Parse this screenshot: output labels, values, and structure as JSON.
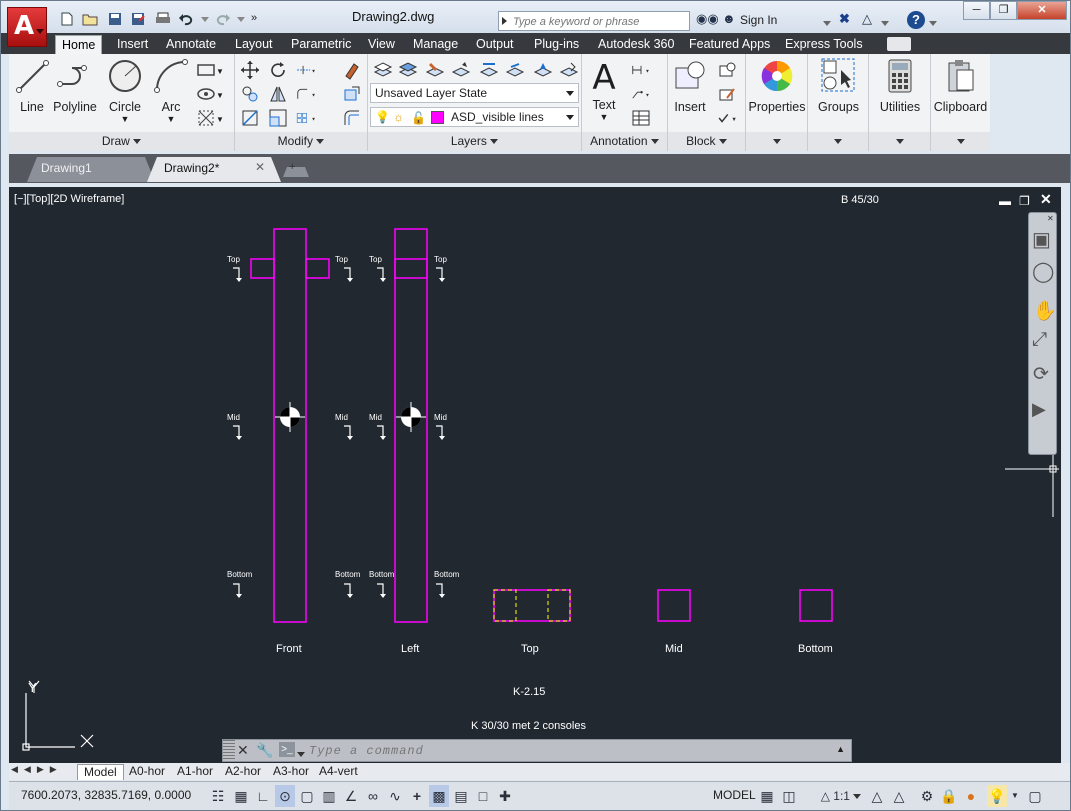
{
  "app": {
    "document_title": "Drawing2.dwg",
    "search_placeholder": "Type a keyword or phrase",
    "sign_in": "Sign In"
  },
  "ribbon_tabs": [
    "Home",
    "Insert",
    "Annotate",
    "Layout",
    "Parametric",
    "View",
    "Manage",
    "Output",
    "Plug-ins",
    "Autodesk 360",
    "Featured Apps",
    "Express Tools"
  ],
  "panels": {
    "draw": {
      "title": "Draw",
      "tools": [
        "Line",
        "Polyline",
        "Circle",
        "Arc"
      ]
    },
    "modify": {
      "title": "Modify"
    },
    "layers": {
      "title": "Layers",
      "layer_state": "Unsaved Layer State",
      "current_layer": "ASD_visible lines",
      "layer_color": "#ff00ff"
    },
    "annotation": {
      "title": "Annotation",
      "text_label": "Text"
    },
    "block": {
      "title": "Block",
      "insert_label": "Insert"
    },
    "properties": {
      "label": "Properties"
    },
    "groups": {
      "label": "Groups"
    },
    "utilities": {
      "label": "Utilities"
    },
    "clipboard": {
      "label": "Clipboard"
    }
  },
  "file_tabs": [
    {
      "label": "Drawing1",
      "active": false
    },
    {
      "label": "Drawing2*",
      "active": true
    }
  ],
  "viewport": {
    "label": "[−][Top][2D Wireframe]",
    "scale_label": "B 45/30"
  },
  "drawing": {
    "column_color": "#ff00ff",
    "hidden_line_color": "#ffff00",
    "section_markers": {
      "top": "Top",
      "mid": "Mid",
      "bottom": "Bottom"
    },
    "view_labels": [
      "Front",
      "Left",
      "Top",
      "Mid",
      "Bottom"
    ],
    "code": "K-2.15",
    "description": "K 30/30 met 2 consoles",
    "ucs_labels": [
      "Y",
      "X"
    ]
  },
  "command_line": {
    "placeholder": "Type a command"
  },
  "layout_tabs": [
    "Model",
    "A0-hor",
    "A1-hor",
    "A2-hor",
    "A3-hor",
    "A4-vert"
  ],
  "status": {
    "coordinates": "7600.2073, 32835.7169, 0.0000",
    "model": "MODEL",
    "annotation_scale": "1:1"
  },
  "colors": {
    "accent_red": "#c0171a",
    "canvas_bg": "#212830",
    "ribbon_bar": "#36393e"
  }
}
